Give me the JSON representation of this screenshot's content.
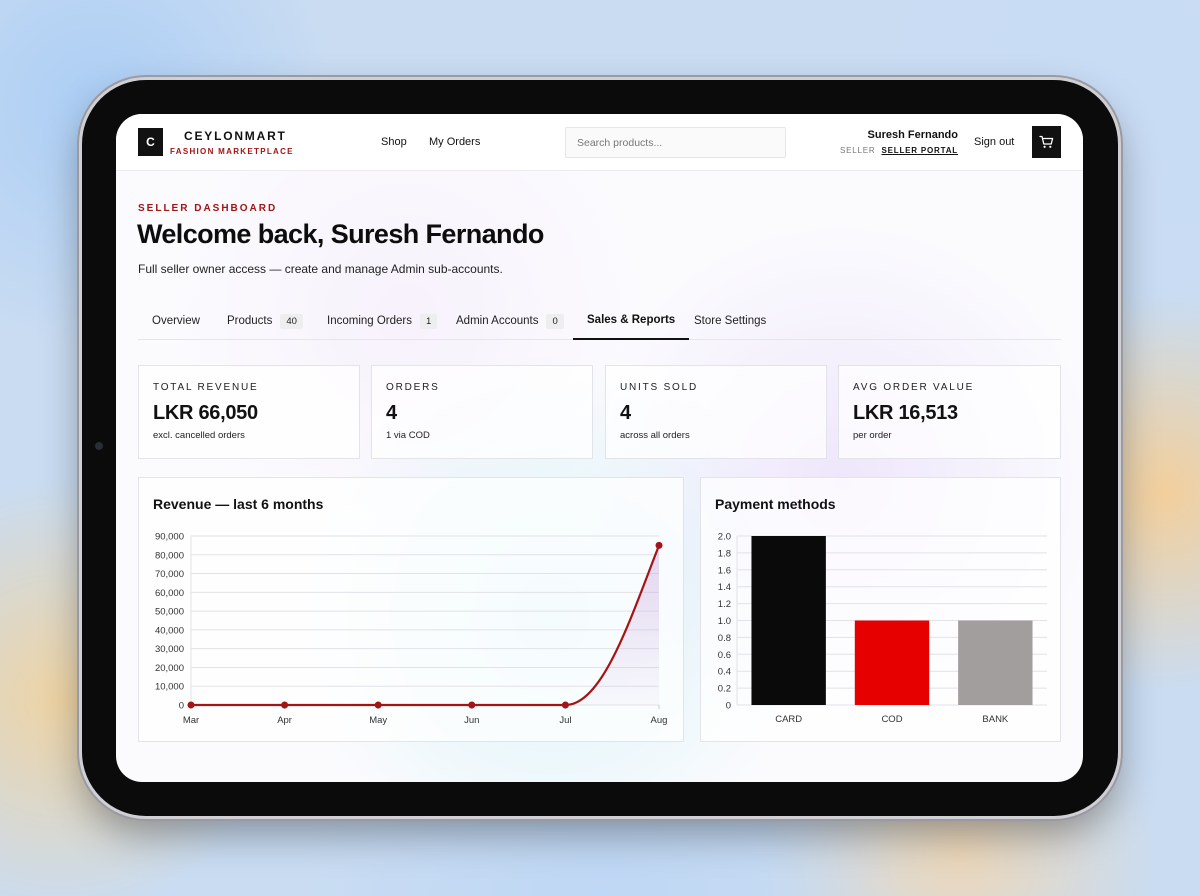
{
  "header": {
    "logo_letter": "C",
    "brand_name": "CEYLONMART",
    "brand_sub": "FASHION MARKETPLACE",
    "nav": [
      "Shop",
      "My Orders"
    ],
    "search_placeholder": "Search products...",
    "user_name": "Suresh Fernando",
    "role_tag": "SELLER",
    "portal_link": "SELLER PORTAL",
    "sign_out": "Sign out",
    "cart_icon": "cart-icon"
  },
  "page": {
    "eyebrow": "SELLER DASHBOARD",
    "title": "Welcome back, Suresh Fernando",
    "subtitle": "Full seller owner access — create and manage Admin sub-accounts."
  },
  "tabs": [
    {
      "label": "Overview",
      "count": null,
      "active": false
    },
    {
      "label": "Products",
      "count": "40",
      "active": false
    },
    {
      "label": "Incoming Orders",
      "count": "1",
      "active": false
    },
    {
      "label": "Admin Accounts",
      "count": "0",
      "active": false
    },
    {
      "label": "Sales & Reports",
      "count": null,
      "active": true
    },
    {
      "label": "Store Settings",
      "count": null,
      "active": false
    }
  ],
  "stats": [
    {
      "label": "TOTAL REVENUE",
      "value": "LKR 66,050",
      "note": "excl. cancelled orders"
    },
    {
      "label": "ORDERS",
      "value": "4",
      "note": "1 via COD"
    },
    {
      "label": "UNITS SOLD",
      "value": "4",
      "note": "across all orders"
    },
    {
      "label": "AVG ORDER VALUE",
      "value": "LKR 16,513",
      "note": "per order"
    }
  ],
  "colors": {
    "accent": "#a01515",
    "line": "#a31515",
    "card_bar": "#0a0a0a",
    "cod_bar": "#e60000",
    "bank_bar": "#a29e9e"
  },
  "chart_data": [
    {
      "type": "line",
      "title": "Revenue — last 6 months",
      "x": [
        "Mar",
        "Apr",
        "May",
        "Jun",
        "Jul",
        "Aug"
      ],
      "series": [
        {
          "values": [
            0,
            0,
            0,
            0,
            0,
            85000
          ]
        }
      ],
      "ylim": [
        0,
        90000
      ],
      "yticks": [
        "0",
        "10,000",
        "20,000",
        "30,000",
        "40,000",
        "50,000",
        "60,000",
        "70,000",
        "80,000",
        "90,000"
      ],
      "grid": true,
      "area_fill": true
    },
    {
      "type": "bar",
      "title": "Payment methods",
      "categories": [
        "CARD",
        "COD",
        "BANK"
      ],
      "values": [
        2,
        1,
        1
      ],
      "ylim": [
        0,
        2.0
      ],
      "yticks": [
        "0",
        "0.2",
        "0.4",
        "0.6",
        "0.8",
        "1.0",
        "1.2",
        "1.4",
        "1.6",
        "1.8",
        "2.0"
      ],
      "grid": true
    }
  ]
}
